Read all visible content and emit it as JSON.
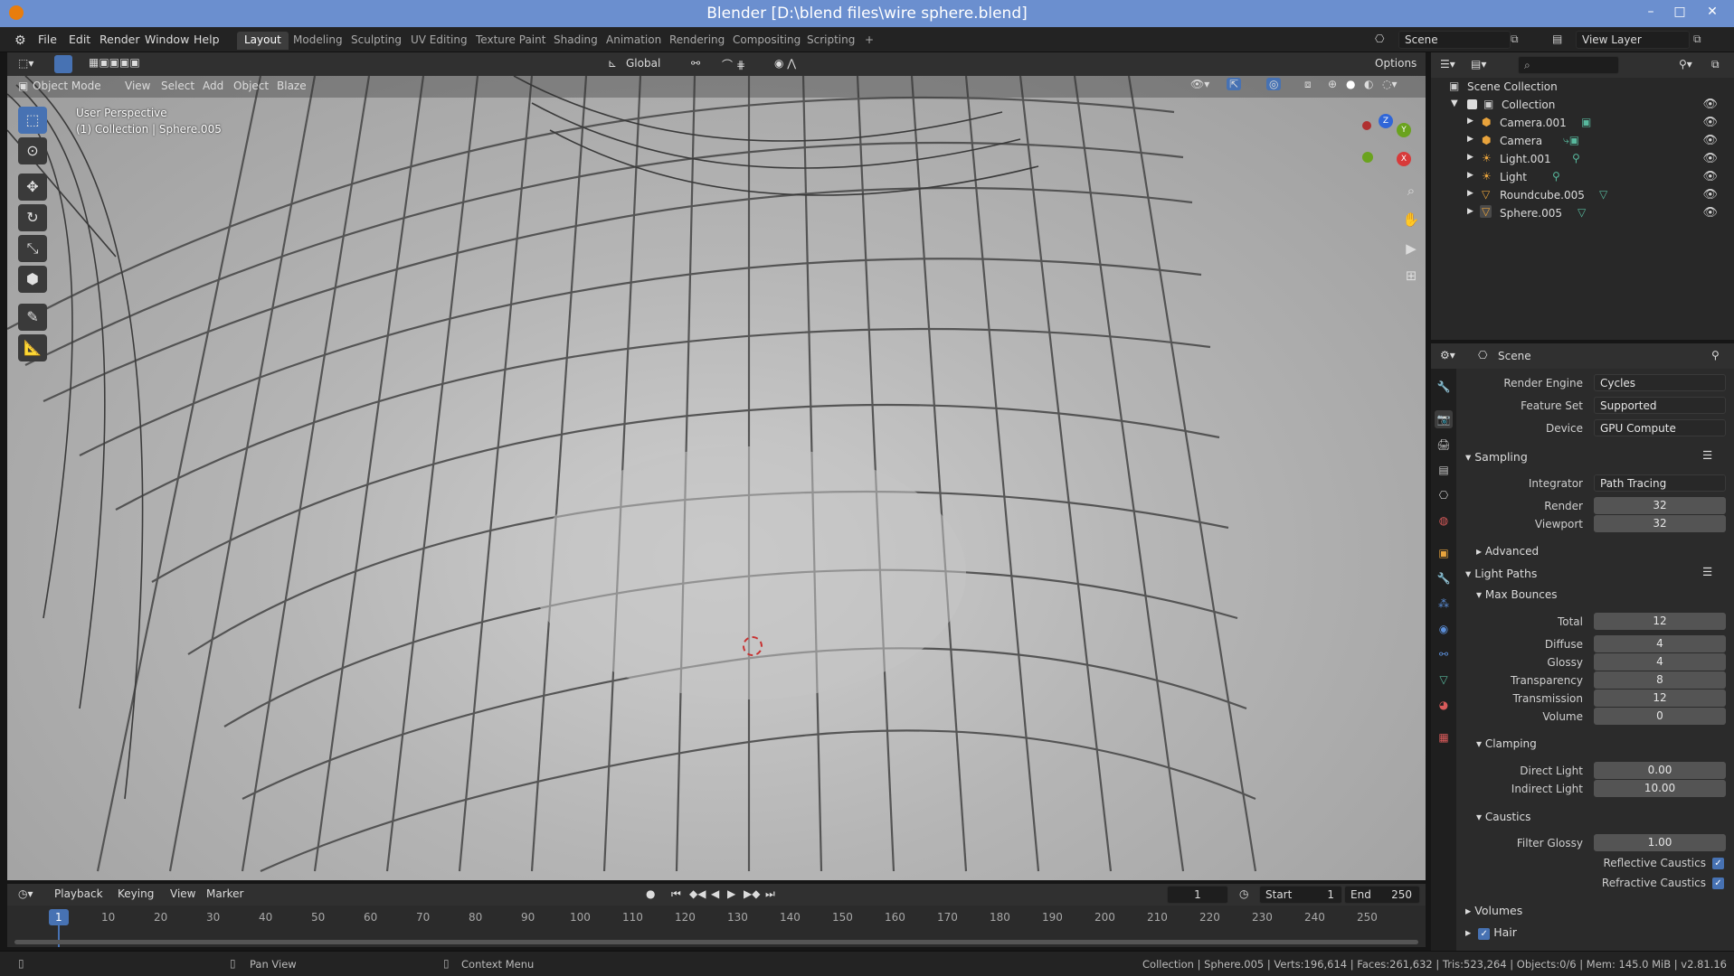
{
  "window": {
    "title": "Blender [D:\\blend files\\wire sphere.blend]",
    "minimize": "–",
    "maximize": "□",
    "close": "✕"
  },
  "menu": [
    "File",
    "Edit",
    "Render",
    "Window",
    "Help"
  ],
  "workspaces": [
    "Layout",
    "Modeling",
    "Sculpting",
    "UV Editing",
    "Texture Paint",
    "Shading",
    "Animation",
    "Rendering",
    "Compositing",
    "Scripting"
  ],
  "workspace_add": "+",
  "scene": {
    "name": "Scene",
    "view_layer": "View Layer"
  },
  "viewport": {
    "mode": "Object Mode",
    "header_menus": [
      "View",
      "Select",
      "Add",
      "Object",
      "Blaze"
    ],
    "orientation": "Global",
    "options": "Options",
    "overlay_perspective": "User Perspective",
    "overlay_collection": "(1) Collection | Sphere.005",
    "gizmo": {
      "z": "Z",
      "y": "Y",
      "x": "X"
    }
  },
  "outliner": {
    "root": "Scene Collection",
    "collection": "Collection",
    "items": [
      {
        "name": "Camera.001",
        "icon": "camera-icon"
      },
      {
        "name": "Camera",
        "icon": "camera-icon"
      },
      {
        "name": "Light.001",
        "icon": "light-icon"
      },
      {
        "name": "Light",
        "icon": "light-icon"
      },
      {
        "name": "Roundcube.005",
        "icon": "mesh-icon"
      },
      {
        "name": "Sphere.005",
        "icon": "mesh-icon"
      }
    ]
  },
  "properties": {
    "context": "Scene",
    "render_engine_label": "Render Engine",
    "render_engine": "Cycles",
    "feature_set_label": "Feature Set",
    "feature_set": "Supported",
    "device_label": "Device",
    "device": "GPU Compute",
    "sampling": "Sampling",
    "integrator_label": "Integrator",
    "integrator": "Path Tracing",
    "render_label": "Render",
    "render": "32",
    "viewport_label": "Viewport",
    "viewport": "32",
    "advanced": "Advanced",
    "light_paths": "Light Paths",
    "max_bounces": "Max Bounces",
    "total_label": "Total",
    "total": "12",
    "diffuse_label": "Diffuse",
    "diffuse": "4",
    "glossy_label": "Glossy",
    "glossy": "4",
    "transparency_label": "Transparency",
    "transparency": "8",
    "transmission_label": "Transmission",
    "transmission": "12",
    "volume_label": "Volume",
    "volume": "0",
    "clamping": "Clamping",
    "direct_light_label": "Direct Light",
    "direct_light": "0.00",
    "indirect_light_label": "Indirect Light",
    "indirect_light": "10.00",
    "caustics": "Caustics",
    "filter_glossy_label": "Filter Glossy",
    "filter_glossy": "1.00",
    "reflective_caustics": "Reflective Caustics",
    "refractive_caustics": "Refractive Caustics",
    "volumes": "Volumes",
    "hair": "Hair"
  },
  "timeline": {
    "menus": [
      "Playback",
      "Keying",
      "View",
      "Marker"
    ],
    "current_frame": "1",
    "start_label": "Start",
    "start": "1",
    "end_label": "End",
    "end": "250",
    "ticks": [
      "1",
      "10",
      "20",
      "30",
      "40",
      "50",
      "60",
      "70",
      "80",
      "90",
      "100",
      "110",
      "120",
      "130",
      "140",
      "150",
      "160",
      "170",
      "180",
      "190",
      "200",
      "210",
      "220",
      "230",
      "240",
      "250"
    ]
  },
  "status": {
    "pan": "Pan View",
    "context_menu": "Context Menu",
    "stats": "Collection | Sphere.005 | Verts:196,614 | Faces:261,632 | Tris:523,264 | Objects:0/6 | Mem: 145.0 MiB | v2.81.16"
  },
  "colors": {
    "accent": "#4772b3",
    "titlebar": "#6b8fcf",
    "panel": "#2b2b2b"
  }
}
